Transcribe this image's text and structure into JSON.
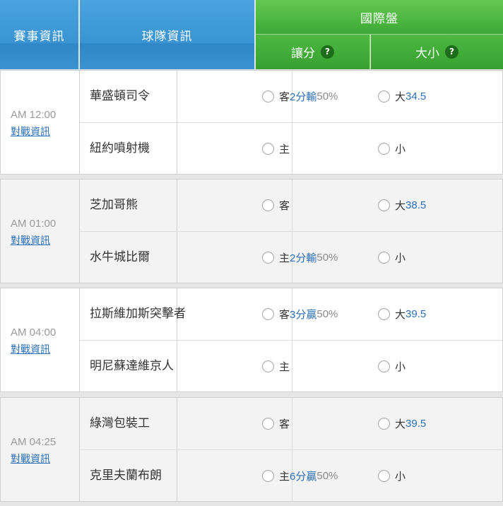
{
  "header": {
    "event_info": "賽事資訊",
    "team_info": "球隊資訊",
    "international": "國際盤",
    "spread": "讓分",
    "total": "大小",
    "help": "?"
  },
  "games": [
    {
      "time": "AM 12:00",
      "link": "對戰資訊",
      "away": {
        "team": "華盛頓司令",
        "side": "客",
        "handicap": "2分輸",
        "pct": "50%",
        "ou": "大",
        "line": "34.5"
      },
      "home": {
        "team": "紐約噴射機",
        "side": "主",
        "handicap": "",
        "pct": "",
        "ou": "小",
        "line": ""
      }
    },
    {
      "time": "AM 01:00",
      "link": "對戰資訊",
      "away": {
        "team": "芝加哥熊",
        "side": "客",
        "handicap": "",
        "pct": "",
        "ou": "大",
        "line": "38.5"
      },
      "home": {
        "team": "水牛城比爾",
        "side": "主",
        "handicap": "2分輸",
        "pct": "50%",
        "ou": "小",
        "line": ""
      }
    },
    {
      "time": "AM 04:00",
      "link": "對戰資訊",
      "away": {
        "team": "拉斯維加斯突擊者",
        "side": "客",
        "handicap": "3分贏",
        "pct": "50%",
        "ou": "大",
        "line": "39.5"
      },
      "home": {
        "team": "明尼蘇達維京人",
        "side": "主",
        "handicap": "",
        "pct": "",
        "ou": "小",
        "line": ""
      }
    },
    {
      "time": "AM 04:25",
      "link": "對戰資訊",
      "away": {
        "team": "綠灣包裝工",
        "side": "客",
        "handicap": "",
        "pct": "",
        "ou": "大",
        "line": "39.5"
      },
      "home": {
        "team": "克里夫蘭布朗",
        "side": "主",
        "handicap": "6分贏",
        "pct": "50%",
        "ou": "小",
        "line": ""
      }
    }
  ]
}
